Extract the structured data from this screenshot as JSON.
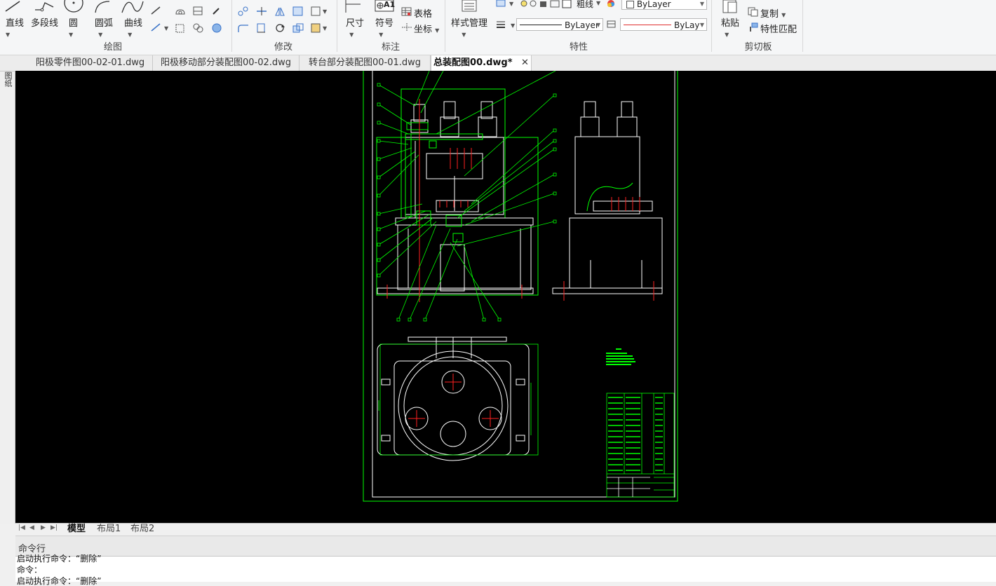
{
  "ribbon": {
    "draw_group": {
      "label": "绘图",
      "line": "直线",
      "polyline": "多段线",
      "circle": "圆",
      "arc": "圆弧",
      "spline": "曲线"
    },
    "modify_group": {
      "label": "修改"
    },
    "annotate_group": {
      "label": "标注",
      "dimension": "尺寸",
      "symbol": "符号",
      "table": "表格",
      "coordinate": "坐标",
      "symbol_icon_text": "A1"
    },
    "properties_group": {
      "label": "特性",
      "style_manager": "样式管理",
      "lineweight_label": "粗线",
      "color_combo": "ByLayer",
      "linetype_combo": "ByLayer",
      "lineweight_combo": "ByLayer"
    },
    "clipboard_group": {
      "label": "剪切板",
      "paste": "粘贴",
      "copy": "复制",
      "match_properties": "特性匹配"
    }
  },
  "sidebar": {
    "label": "图纸"
  },
  "tabs": [
    {
      "label": "阳极零件图00-02-01.dwg",
      "active": false
    },
    {
      "label": "阳极移动部分装配图00-02.dwg",
      "active": false
    },
    {
      "label": "转台部分装配图00-01.dwg",
      "active": false
    },
    {
      "label": "总装配图00.dwg*",
      "active": true
    }
  ],
  "layout_tabs": [
    {
      "label": "模型",
      "active": true
    },
    {
      "label": "布局1",
      "active": false
    },
    {
      "label": "布局2",
      "active": false
    }
  ],
  "command": {
    "title": "命令行",
    "history": [
      "启动执行命令：“删除”",
      "命令：",
      "启动执行命令：“删除”"
    ]
  },
  "colors": {
    "canvas_bg": "#000000",
    "frame_green": "#00ff00",
    "drawing_white": "#ffffff",
    "center_red": "#ff2020",
    "linetype_red": "#e03030"
  }
}
